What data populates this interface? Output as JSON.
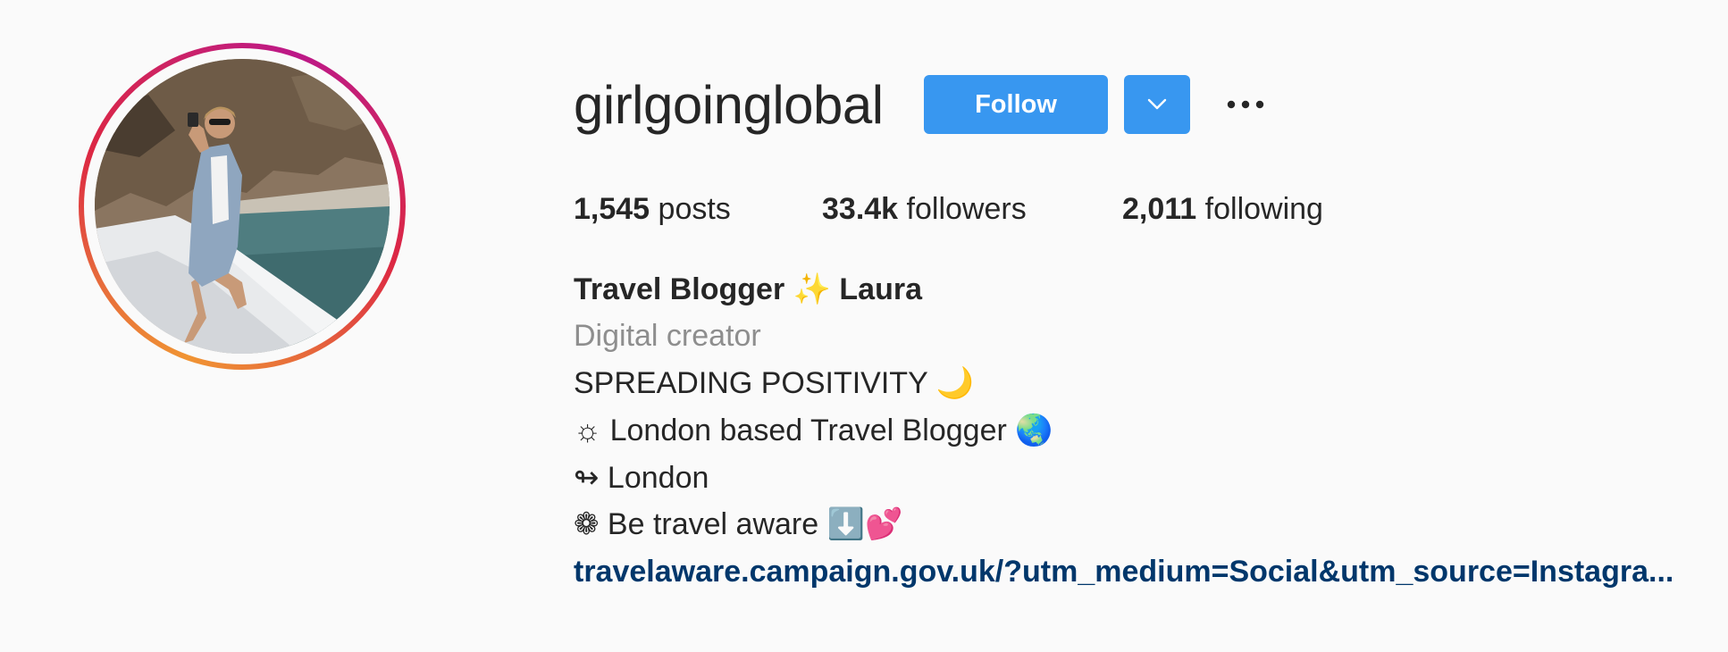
{
  "profile": {
    "username": "girlgoinglobal",
    "follow_label": "Follow",
    "dropdown_icon": "chevron-down-icon",
    "more_icon": "ellipsis-icon",
    "stats": {
      "posts_count": "1,545",
      "posts_label": " posts",
      "followers_count": "33.4k",
      "followers_label": " followers",
      "following_count": "2,011",
      "following_label": " following"
    },
    "full_name": "Travel Blogger ✨ Laura",
    "category": "Digital creator",
    "bio_lines": [
      "SPREADING POSITIVITY 🌙",
      "☼ London based Travel Blogger 🌏",
      "↬ London",
      "❁ Be travel aware ⬇️💕"
    ],
    "link": "travelaware.campaign.gov.uk/?utm_medium=Social&utm_source=Instagra..."
  },
  "colors": {
    "accent_blue": "#3897f0",
    "link_blue": "#00376b",
    "muted_gray": "#8e8e8e",
    "text": "#262626",
    "background": "#fafafa"
  }
}
